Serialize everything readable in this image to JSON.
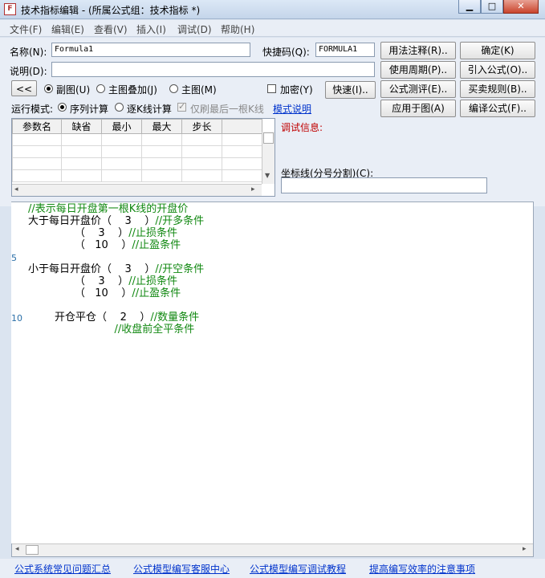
{
  "window": {
    "title": "技术指标编辑 - (所属公式组：技术指标 *)",
    "icon_label": "F",
    "controls": {
      "minimize": "▁",
      "maximize": "□",
      "close": "✕"
    }
  },
  "menu": [
    "文件(F)",
    "编辑(E)",
    "查看(V)",
    "插入(I)",
    "调试(D)",
    "帮助(H)"
  ],
  "form": {
    "name_label": "名称(N):",
    "name_value": "Formula1",
    "shortcut_label": "快捷码(Q):",
    "shortcut_value": "FORMULA1",
    "desc_label": "说明(D):",
    "desc_value": "",
    "back_button": "<<",
    "view_options": [
      "副图(U)",
      "主图叠加(J)",
      "主图(M)"
    ],
    "view_selected": "副图(U)",
    "encrypt_label": "加密(Y)",
    "quick_button": "快速(I)..",
    "run_mode_label": "运行模式:",
    "run_modes": [
      "序列计算",
      "逐K线计算"
    ],
    "run_mode_selected": "序列计算",
    "last_bar_only": "仅刷最后一根K线",
    "mode_help_link": "模式说明",
    "buttons": {
      "usage": "用法注释(R)..",
      "confirm": "确定(K)",
      "period": "使用周期(P)..",
      "import": "引入公式(O)..",
      "test": "公式测评(E)..",
      "trade_rules": "买卖规则(B)..",
      "apply": "应用于图(A)",
      "compile": "编译公式(F).."
    },
    "params_table": {
      "columns": [
        "参数名",
        "缺省",
        "最小",
        "最大",
        "步长"
      ],
      "rows": [
        [
          "",
          "",
          "",
          "",
          ""
        ],
        [
          "",
          "",
          "",
          "",
          ""
        ],
        [
          "",
          "",
          "",
          "",
          ""
        ],
        [
          "",
          "",
          "",
          "",
          ""
        ]
      ]
    },
    "debug_label": "调试信息:",
    "coord_label": "坐标线(分号分割)(C):",
    "coord_value": ""
  },
  "editor": {
    "line_numbers": [
      "5",
      "10"
    ],
    "lines": [
      {
        "code": "",
        "comment": "//表示每日开盘第一根K线的开盘价"
      },
      {
        "code": "大于每日开盘价（    3    ）",
        "comment": "//开多条件"
      },
      {
        "code": "              （    3    ）",
        "comment": "//止损条件"
      },
      {
        "code": "              （   10    ）",
        "comment": "//止盈条件"
      },
      {
        "code": "",
        "comment": ""
      },
      {
        "code": "小于每日开盘价（    3    ）",
        "comment": "//开空条件"
      },
      {
        "code": "              （    3    ）",
        "comment": "//止损条件"
      },
      {
        "code": "              （   10    ）",
        "comment": "//止盈条件"
      },
      {
        "code": "",
        "comment": ""
      },
      {
        "code": "        开仓平仓（    2    ）",
        "comment": "//数量条件"
      },
      {
        "code": "                          ",
        "comment": "//收盘前全平条件"
      }
    ]
  },
  "footer_links": [
    "公式系统常见问题汇总",
    "公式模型编写客服中心",
    "公式模型编写调试教程",
    "提高编写效率的注意事项"
  ]
}
